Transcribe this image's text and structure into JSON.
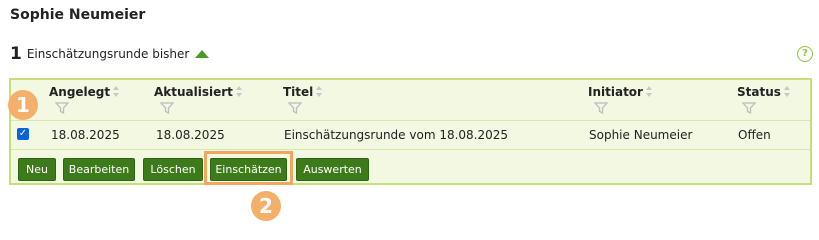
{
  "page": {
    "title": "Sophie Neumeier",
    "count": "1",
    "count_label": "Einschätzungsrunde bisher",
    "help_label": "?"
  },
  "table": {
    "columns": [
      "Angelegt",
      "Aktualisiert",
      "Titel",
      "Initiator",
      "Status"
    ],
    "rows": [
      {
        "checked": true,
        "angelegt": "18.08.2025",
        "aktualisiert": "18.08.2025",
        "titel": "Einschätzungsrunde vom 18.08.2025",
        "initiator": "Sophie Neumeier",
        "status": "Offen"
      }
    ]
  },
  "buttons": {
    "neu": "Neu",
    "bearbeiten": "Bearbeiten",
    "loeschen": "Löschen",
    "einschaetzen": "Einschätzen",
    "auswerten": "Auswerten"
  },
  "annotations": {
    "badge1": "1",
    "badge2": "2"
  },
  "colors": {
    "accent": "#3d7a1a",
    "panel": "#f2f8e1",
    "panel_border": "#c5e07a",
    "highlight": "#f0a860"
  }
}
